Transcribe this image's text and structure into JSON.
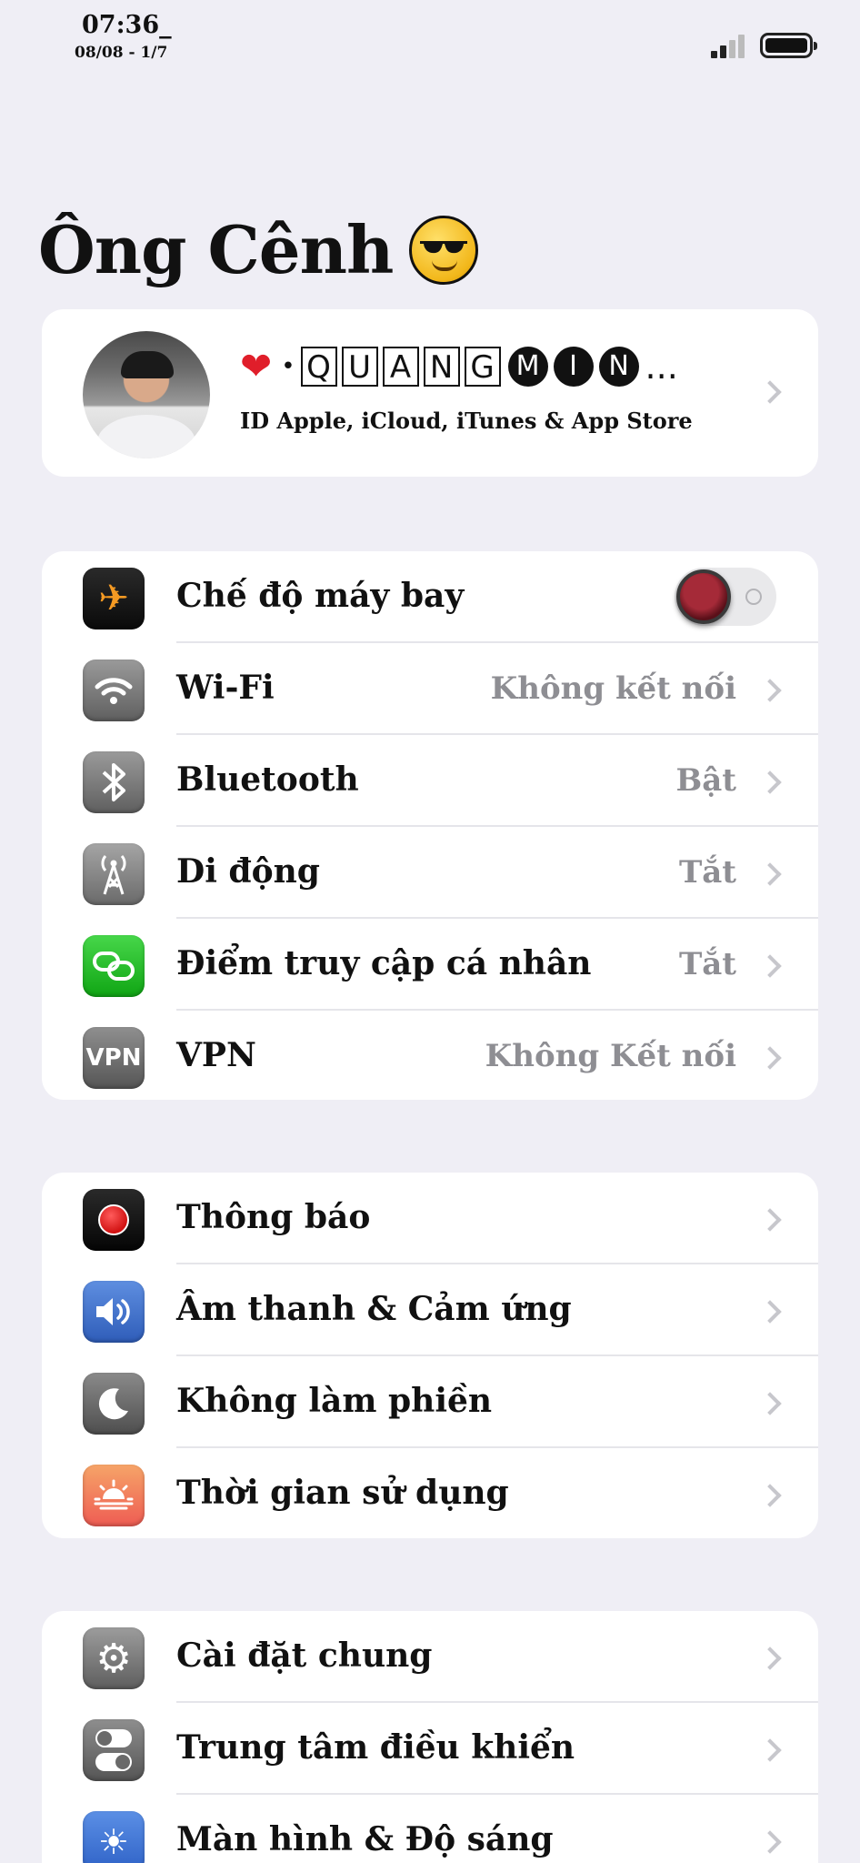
{
  "status_bar": {
    "time": "07:36_",
    "date": "08/08 - 1/7"
  },
  "header": {
    "title": "Ông Cênh",
    "emoji": "smiling-face-with-sunglasses-icon"
  },
  "profile": {
    "heart": "❤",
    "dot": "•",
    "boxed_letters": [
      "Q",
      "U",
      "A",
      "N",
      "G"
    ],
    "circled_letters": [
      "M",
      "I",
      "N"
    ],
    "ellipsis": "...",
    "subtitle": "ID Apple, iCloud, iTunes & App Store"
  },
  "group1": [
    {
      "label": "Chế độ máy bay",
      "icon": "airplane-icon",
      "toggle_on": false
    },
    {
      "label": "Wi-Fi",
      "value": "Không kết nối",
      "icon": "wifi-icon"
    },
    {
      "label": "Bluetooth",
      "value": "Bật",
      "icon": "bluetooth-icon"
    },
    {
      "label": "Di động",
      "value": "Tắt",
      "icon": "cellular-antenna-icon"
    },
    {
      "label": "Điểm truy cập cá nhân",
      "value": "Tắt",
      "icon": "personal-hotspot-icon"
    },
    {
      "label": "VPN",
      "value": "Không Kết nối",
      "icon": "vpn-icon",
      "icon_text": "VPN"
    }
  ],
  "group2": [
    {
      "label": "Thông báo",
      "icon": "notifications-icon"
    },
    {
      "label": "Âm thanh & Cảm ứng",
      "icon": "speaker-icon"
    },
    {
      "label": "Không làm phiền",
      "icon": "moon-icon"
    },
    {
      "label": "Thời gian sử dụng",
      "icon": "screen-time-icon"
    }
  ],
  "group3": [
    {
      "label": "Cài đặt chung",
      "icon": "gear-icon"
    },
    {
      "label": "Trung tâm điều khiển",
      "icon": "control-center-icon"
    },
    {
      "label": "Màn hình & Độ sáng",
      "icon": "brightness-icon"
    }
  ],
  "colors": {
    "background": "#efeef5",
    "card": "#ffffff",
    "secondary_text": "#8e8e93",
    "airplane_orange": "#f59a23",
    "hotspot_green": "#10a514",
    "notification_red": "#d11212"
  }
}
